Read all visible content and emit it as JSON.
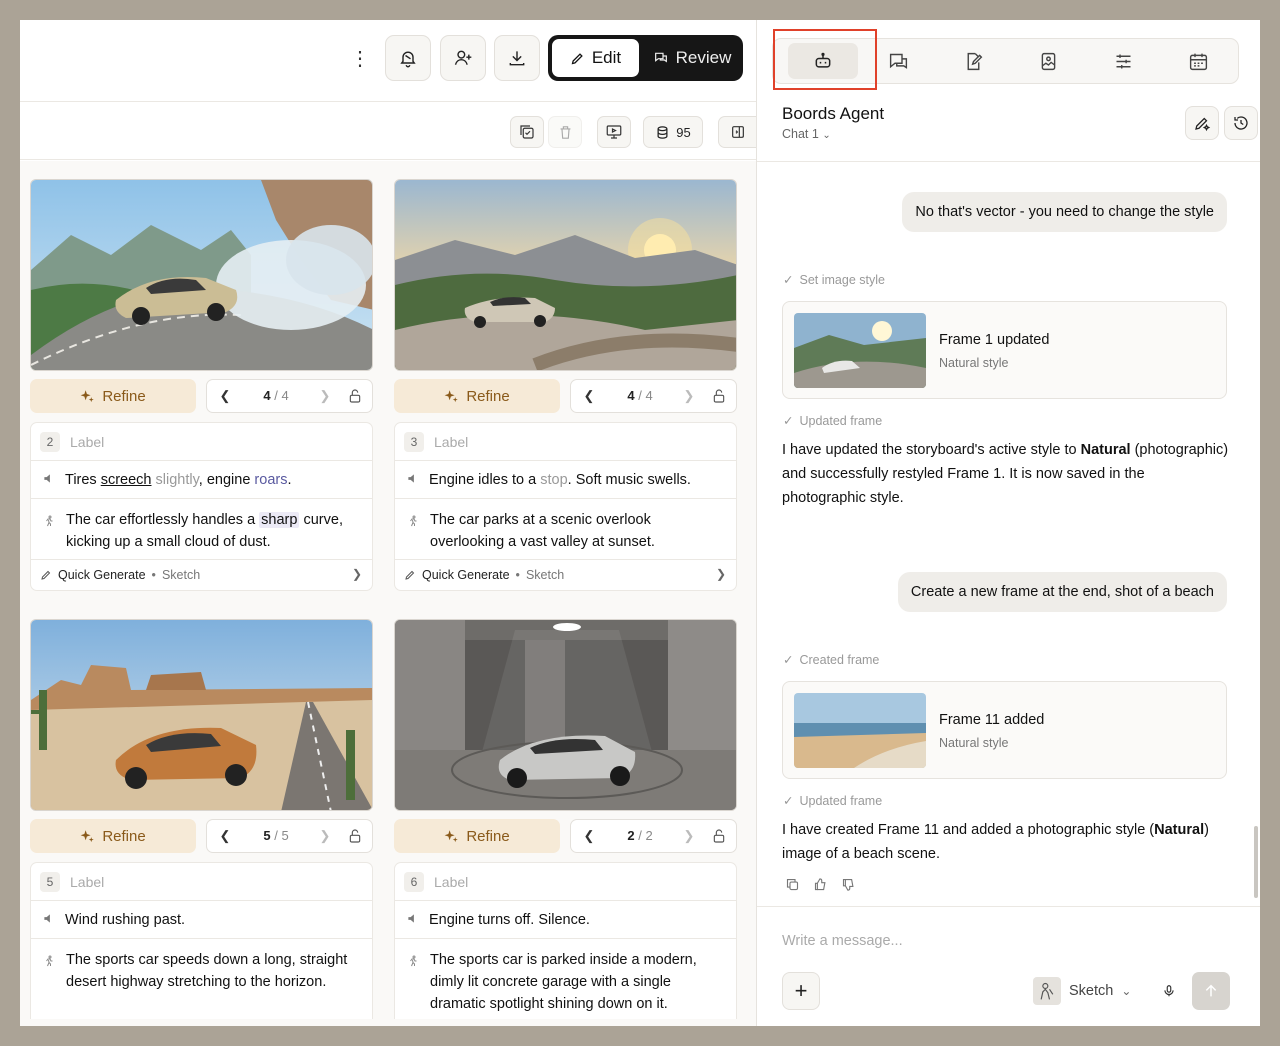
{
  "toolbar": {
    "edit_label": "Edit",
    "review_label": "Review",
    "credits": "95"
  },
  "frames": [
    {
      "number": "2",
      "label_placeholder": "Label",
      "refine": "Refine",
      "page_current": "4",
      "page_total": "4",
      "sound_parts": [
        "Tires ",
        "screech",
        " ",
        "slightly",
        ", engine ",
        "roars",
        "."
      ],
      "action_parts": [
        "The car effortlessly handles a ",
        "sharp",
        " curve, kicking up a small cloud of dust."
      ],
      "mode": "Quick Generate",
      "style": "Sketch"
    },
    {
      "number": "3",
      "label_placeholder": "Label",
      "refine": "Refine",
      "page_current": "4",
      "page_total": "4",
      "sound_parts": [
        "Engine idles to a ",
        "stop",
        ". Soft music swells."
      ],
      "action_parts": [
        "The car parks at a scenic overlook overlooking a vast valley at sunset."
      ],
      "mode": "Quick Generate",
      "style": "Sketch"
    },
    {
      "number": "5",
      "label_placeholder": "Label",
      "refine": "Refine",
      "page_current": "5",
      "page_total": "5",
      "sound_parts": [
        "Wind rushing past."
      ],
      "action_parts": [
        "The sports car speeds down a long, straight desert highway stretching to the horizon."
      ]
    },
    {
      "number": "6",
      "label_placeholder": "Label",
      "refine": "Refine",
      "page_current": "2",
      "page_total": "2",
      "sound_parts": [
        "Engine turns off. Silence."
      ],
      "action_parts": [
        "The sports car is parked inside a modern, dimly lit concrete garage with a single dramatic spotlight shining down on it."
      ]
    }
  ],
  "agent": {
    "title": "Boords Agent",
    "chat": "Chat 1"
  },
  "messages": {
    "user1": "No that's vector - you need to change the style",
    "tool1": "Set image style",
    "card1_title": "Frame 1 updated",
    "card1_sub": "Natural style",
    "tool2": "Updated frame",
    "reply1_parts": [
      "I have updated the storyboard's active style to ",
      "Natural",
      " (photographic) and successfully restyled Frame 1. It is now saved in the photographic style."
    ],
    "user2": "Create a new frame at the end, shot of a beach",
    "tool3": "Created frame",
    "card2_title": "Frame 11 added",
    "card2_sub": "Natural style",
    "tool4": "Updated frame",
    "reply2_parts": [
      "I have created Frame 11 and added a photographic style (",
      "Natural",
      ") image of a beach scene."
    ]
  },
  "composer": {
    "placeholder": "Write a message...",
    "style": "Sketch"
  },
  "colors": {
    "refine_bg": "#f6ead7",
    "refine_text": "#8a5a1a",
    "highlight": "#e0412a",
    "mode_bg": "#161616"
  }
}
